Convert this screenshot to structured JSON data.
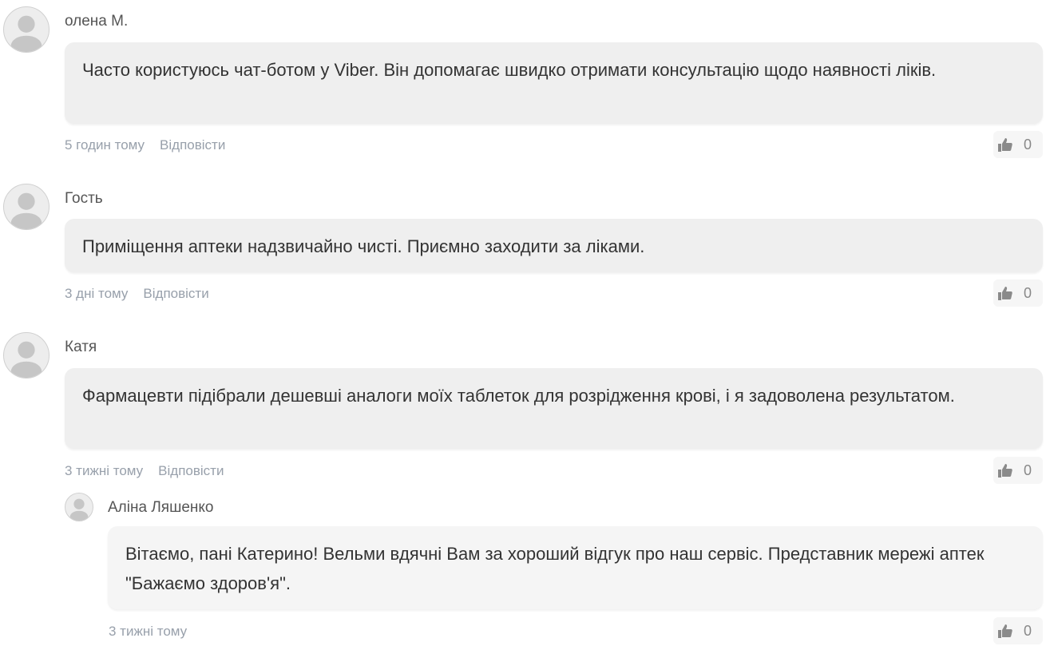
{
  "comments": [
    {
      "author": "олена М.",
      "text": "Часто користуюсь чат-ботом у Viber. Він допомагає швидко отримати консультацію щодо наявності ліків.",
      "time": "5 годин тому",
      "reply_label": "Відповісти",
      "likes": "0"
    },
    {
      "author": "Гость",
      "text": "Приміщення аптеки надзвичайно чисті. Приємно заходити за ліками.",
      "time": "3 дні тому",
      "reply_label": "Відповісти",
      "likes": "0"
    },
    {
      "author": "Катя",
      "text": "Фармацевти підібрали дешевші аналоги моїх таблеток для розрідження крові, і я задоволена результатом.",
      "time": "3 тижні тому",
      "reply_label": "Відповісти",
      "likes": "0"
    }
  ],
  "reply": {
    "author": "Аліна Ляшенко",
    "text": "Вітаємо, пані Катерино! Вельми вдячні Вам за хороший відгук про наш сервіс. Представник мережі аптек \"Бажаємо здоров'я\".",
    "time": "3 тижні тому",
    "likes": "0"
  },
  "icons": {
    "avatar": "user-avatar-icon",
    "like": "thumbs-up-icon"
  }
}
